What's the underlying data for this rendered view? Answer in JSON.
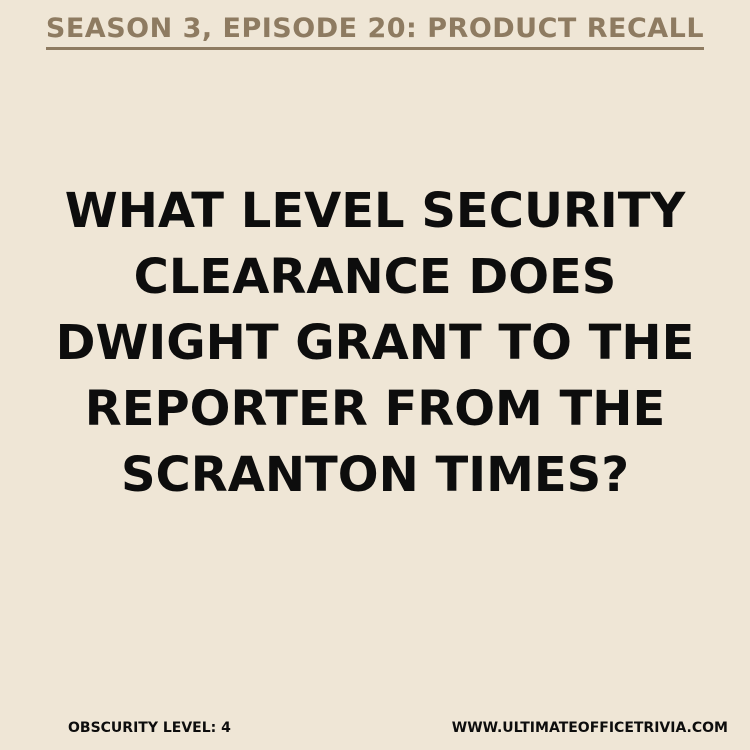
{
  "header": {
    "episode_title": "SEASON 3, EPISODE 20: PRODUCT RECALL"
  },
  "question": {
    "lines": [
      "WHAT LEVEL SECURITY",
      "CLEARANCE DOES",
      "DWIGHT GRANT TO THE",
      "REPORTER FROM THE",
      "SCRANTON TIMES?"
    ]
  },
  "footer": {
    "obscurity": "OBSCURITY LEVEL: 4",
    "website": "WWW.ULTIMATEOFFICETRIVIA.COM"
  },
  "colors": {
    "background": "#efe6d6",
    "header_text": "#8e7b61",
    "body_text": "#0d0d0d"
  }
}
